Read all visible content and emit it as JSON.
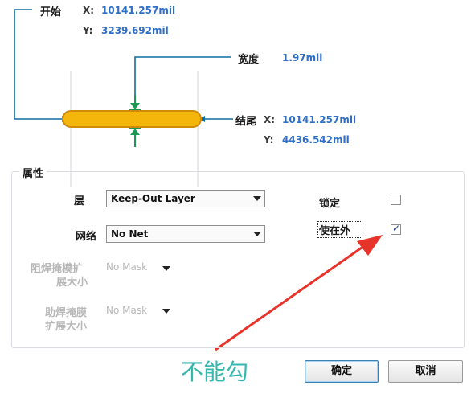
{
  "diagram": {
    "start_label": "开始",
    "start_x_label": "X:",
    "start_x_value": "10141.257mil",
    "start_y_label": "Y:",
    "start_y_value": "3239.692mil",
    "width_label": "宽度",
    "width_value": "1.97mil",
    "end_label": "结尾",
    "end_x_label": "X:",
    "end_x_value": "10141.257mil",
    "end_y_label": "Y:",
    "end_y_value": "4436.542mil",
    "colors": {
      "track": "#f5b60c",
      "track_outline": "#d18a08",
      "leader": "#0e6f9e",
      "arrow": "#1a9a52"
    }
  },
  "properties": {
    "title": "属性",
    "layer_label": "层",
    "layer_value": "Keep-Out Layer",
    "net_label": "网络",
    "net_value": "No Net",
    "lock_label": "锁定",
    "lock_checked": false,
    "keepout_label": "使在外",
    "keepout_checked": true,
    "keepout_mark": "✓",
    "solder_mask_label_1": "阻焊掩模扩",
    "solder_mask_label_2": "展大小",
    "solder_mask_value": "No Mask",
    "paste_mask_label_1": "助焊掩膜",
    "paste_mask_label_2": "扩展大小",
    "paste_mask_value": "No Mask"
  },
  "buttons": {
    "ok": "确定",
    "cancel": "取消"
  },
  "annotation": {
    "text": "不能勾",
    "color": "#37b6ae",
    "arrow_color": "#e8332b"
  }
}
